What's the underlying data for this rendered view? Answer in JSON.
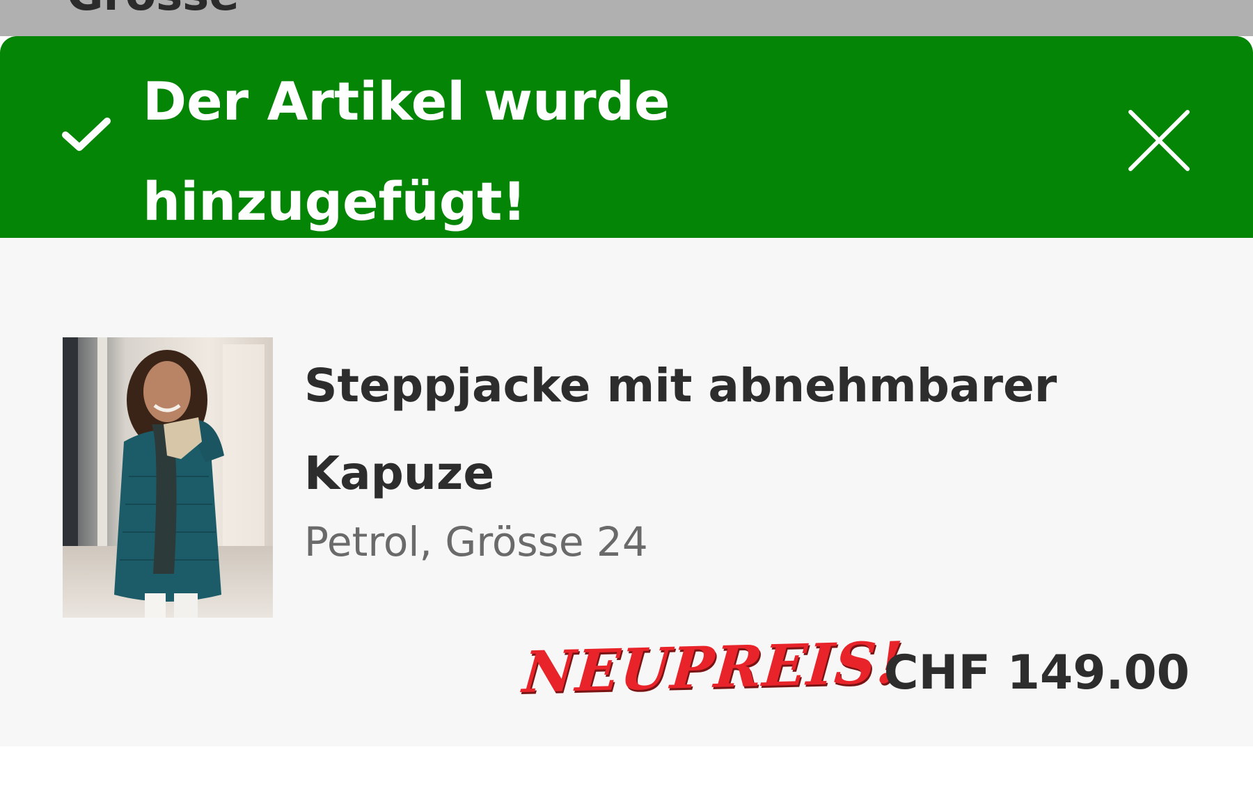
{
  "background_page": {
    "heading": "Grösse"
  },
  "banner": {
    "message": "Der Artikel wurde hinzugefügt!",
    "icon": "check-icon",
    "close_icon": "close-icon",
    "color": "#058505"
  },
  "product": {
    "title": "Steppjacke mit abnehmbarer Kapuze",
    "variant": "Petrol, Grösse 24",
    "promo": "NEUPREIS!",
    "price": "CHF 149.00",
    "promo_color": "#e8242a"
  }
}
